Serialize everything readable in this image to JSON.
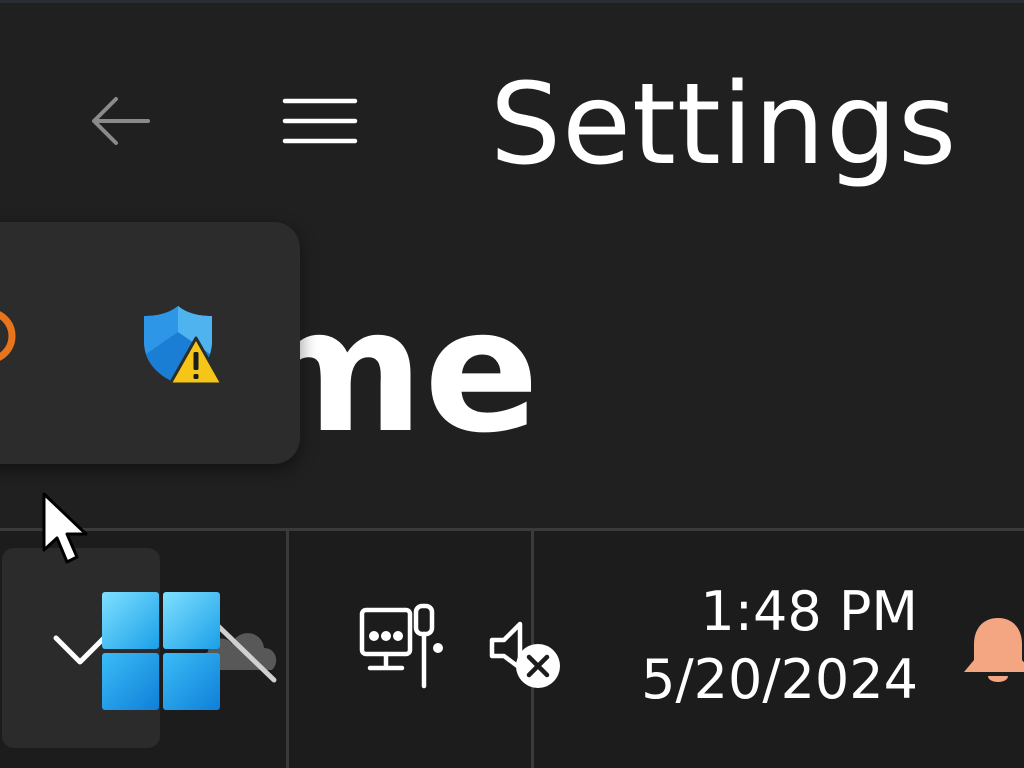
{
  "settings_window": {
    "title": "Settings",
    "page_heading": "ome",
    "nav": {
      "back_icon": "back-arrow-icon",
      "menu_icon": "hamburger-menu-icon"
    }
  },
  "tray_flyout": {
    "items": [
      {
        "icon": "orange-app-icon",
        "color": "#e8741c"
      },
      {
        "icon": "windows-security-warning-icon",
        "shield_color": "#1e88d8",
        "warning_color": "#f5c518"
      }
    ]
  },
  "taskbar": {
    "show_hidden_icons": "chevron-up-icon",
    "start_icon": "windows-logo-icon",
    "start_color": "#2aa8f0",
    "onedrive_icon": "onedrive-offline-icon",
    "network_icon": "network-disconnected-icon",
    "volume_icon": "volume-muted-icon",
    "clock": {
      "time": "1:48 PM",
      "date": "5/20/2024"
    },
    "notification_icon": "notification-bell-icon",
    "notification_color": "#f4a582"
  }
}
